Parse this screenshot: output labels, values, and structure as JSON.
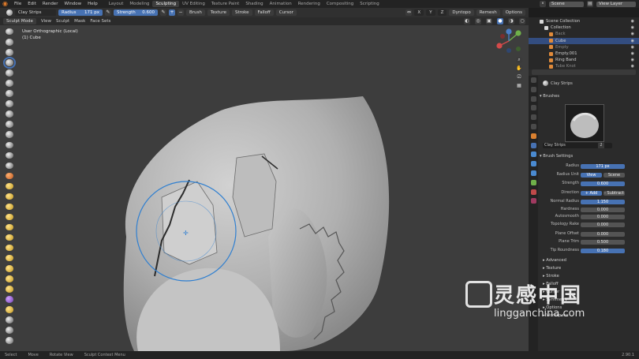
{
  "topbar": {
    "logo_icon": "blender-logo-icon",
    "menus": [
      "File",
      "Edit",
      "Render",
      "Window",
      "Help"
    ],
    "workspaces": [
      "Layout",
      "Modeling",
      "Sculpting",
      "UV Editing",
      "Texture Paint",
      "Shading",
      "Animation",
      "Rendering",
      "Compositing",
      "Scripting"
    ],
    "active_workspace": "Sculpting",
    "scene": "Scene",
    "view_layer": "View Layer"
  },
  "toolheader": {
    "brush_name": "Clay Strips",
    "radius_label": "Radius",
    "radius_value": "171 px",
    "strength_label": "Strength",
    "strength_value": "0.600",
    "menus": [
      "Brush",
      "Texture",
      "Stroke",
      "Falloff",
      "Cursor"
    ],
    "dyntopo": "Dyntopo",
    "remesh": "Remesh",
    "options": "Options"
  },
  "viewheader": {
    "mode": "Sculpt Mode",
    "menus": [
      "View",
      "Sculpt",
      "Mask",
      "Face Sets"
    ]
  },
  "viewport": {
    "overlay_line1": "User Orthographic (Local)",
    "overlay_line2": "(1) Cube"
  },
  "outliner": {
    "rows": [
      {
        "label": "Scene Collection",
        "dim": false,
        "sel": false
      },
      {
        "label": "Collection",
        "dim": false,
        "sel": false
      },
      {
        "label": "Back",
        "dim": true,
        "sel": false
      },
      {
        "label": "Cube",
        "dim": false,
        "sel": true
      },
      {
        "label": "Empty",
        "dim": true,
        "sel": false
      },
      {
        "label": "Empty.001",
        "dim": false,
        "sel": false
      },
      {
        "label": "Ring Band",
        "dim": false,
        "sel": false
      },
      {
        "label": "Tube Knot",
        "dim": true,
        "sel": false
      }
    ]
  },
  "props": {
    "brush_header": "Clay Strips",
    "brushes_section": "Brushes",
    "brush_field": "Clay Strips",
    "brush_users": "2",
    "brush_settings": "Brush Settings",
    "rows": [
      {
        "label": "Radius",
        "value": "171 px",
        "blue": true
      },
      {
        "label": "Radius Unit",
        "value": "View",
        "value2": "Scene",
        "blue": true
      },
      {
        "label": "Strength",
        "value": "0.600",
        "blue": true
      },
      {
        "label": "Direction",
        "value": "+ Add",
        "value2": "- Subtract",
        "blue": true
      },
      {
        "label": "Normal Radius",
        "value": "1.150",
        "blue": true
      },
      {
        "label": "Hardness",
        "value": "0.000",
        "blue": false
      },
      {
        "label": "Autosmooth",
        "value": "0.000",
        "blue": false
      },
      {
        "label": "Topology Rake",
        "value": "0.000",
        "blue": false
      },
      {
        "label": "Plane Offset",
        "value": "0.000",
        "blue": false
      },
      {
        "label": "Plane Trim",
        "value": "0.500",
        "blue": false
      },
      {
        "label": "Tip Roundness",
        "value": "0.180",
        "blue": true
      }
    ],
    "collapsed": [
      "Advanced",
      "Texture",
      "Stroke",
      "Falloff",
      "Cursor",
      "Symmetry",
      "Options",
      "Workspace"
    ]
  },
  "status": {
    "items": [
      "Select",
      "Move",
      "Rotate View",
      "Sculpt Context Menu"
    ],
    "version": "2.90.1"
  },
  "watermark": {
    "cn": "灵感中国",
    "url": "lingganchina.com"
  },
  "colors": {
    "accent": "#4772b3",
    "selection": "#334d80",
    "viewport_bg": "#3d3d3d",
    "mesh": "#b8b8b8"
  }
}
